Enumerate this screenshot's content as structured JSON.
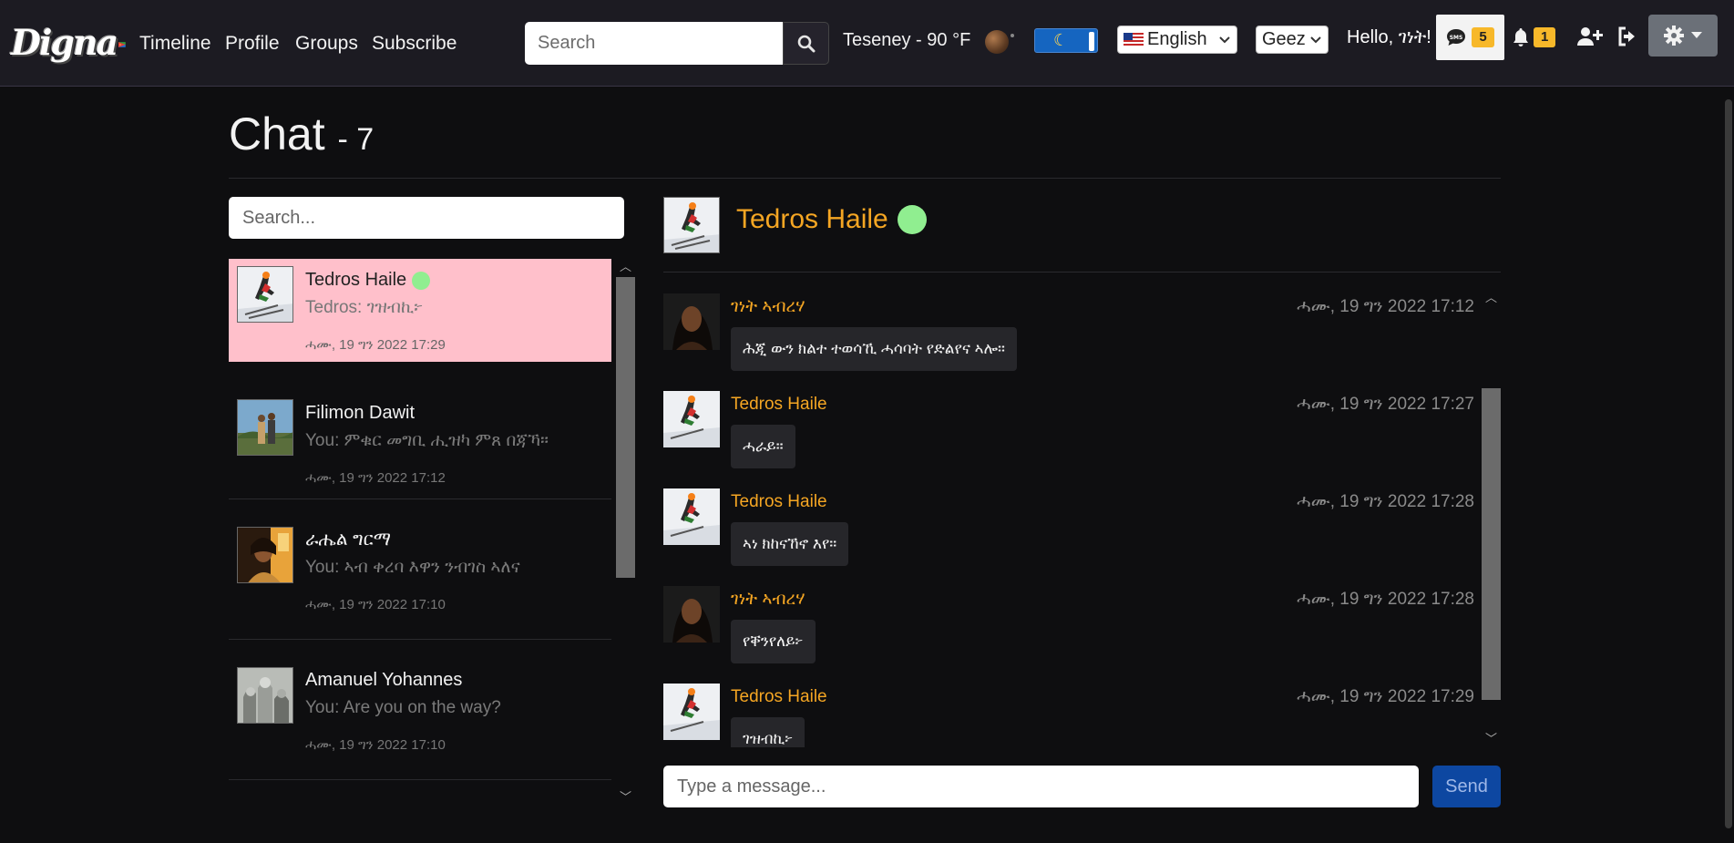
{
  "brand": {
    "logo_text": "Digna"
  },
  "nav": {
    "links": [
      "Timeline",
      "Profile",
      "Groups",
      "Subscribe"
    ],
    "search_placeholder": "Search",
    "weather": "Teseney - 90 °F",
    "language": "English",
    "script": "Geez",
    "greeting": "Hello, ገነት!",
    "sms_count": "5",
    "notification_count": "1"
  },
  "page": {
    "title": "Chat",
    "count_label": "- 7"
  },
  "sidebar": {
    "search_placeholder": "Search...",
    "conversations": [
      {
        "name": "Tedros Haile",
        "online": true,
        "preview": "Tedros: ገዝብኪ፦",
        "time": "ሓሙ, 19 ግን 2022 17:29",
        "active": true
      },
      {
        "name": "Filimon Dawit",
        "online": false,
        "preview": "You: ምቁር መግቢ ሒዝካ ምጸ በጃኻ።",
        "time": "ሓሙ, 19 ግን 2022 17:12",
        "active": false
      },
      {
        "name": "ራሔል ግርማ",
        "online": false,
        "preview": "You: ኣብ ቀረባ እዋን ንብገስ ኣለና",
        "time": "ሓሙ, 19 ግን 2022 17:10",
        "active": false
      },
      {
        "name": "Amanuel Yohannes",
        "online": false,
        "preview": "You: Are you on the way?",
        "time": "ሓሙ, 19 ግን 2022 17:10",
        "active": false
      }
    ]
  },
  "chat": {
    "contact_name": "Tedros Haile",
    "contact_online": true,
    "messages": [
      {
        "sender": "ገነት ኣብረሃ",
        "time": "ሓሙ, 19 ግን 2022 17:12",
        "text": "ሕጂ ውን ክልተ ተወሳኺ ሓሳባት የድልየና ኣሎ።",
        "avatar": "woman"
      },
      {
        "sender": "Tedros Haile",
        "time": "ሓሙ, 19 ግን 2022 17:27",
        "text": "ሓራይ።",
        "avatar": "skier"
      },
      {
        "sender": "Tedros Haile",
        "time": "ሓሙ, 19 ግን 2022 17:28",
        "text": "ኣነ ክከናኸኖ እየ።",
        "avatar": "skier"
      },
      {
        "sender": "ገነት ኣብረሃ",
        "time": "ሓሙ, 19 ግን 2022 17:28",
        "text": "የቐንየለይ፦",
        "avatar": "woman"
      },
      {
        "sender": "Tedros Haile",
        "time": "ሓሙ, 19 ግን 2022 17:29",
        "text": "ገዝብኪ፦",
        "avatar": "skier"
      }
    ],
    "input_placeholder": "Type a message...",
    "send_label": "Send"
  },
  "colors": {
    "accent_orange": "#f5a623",
    "active_row": "#ffc0cb",
    "online": "#90ee90",
    "send": "#0d47a1",
    "badge": "#f7b82a"
  }
}
